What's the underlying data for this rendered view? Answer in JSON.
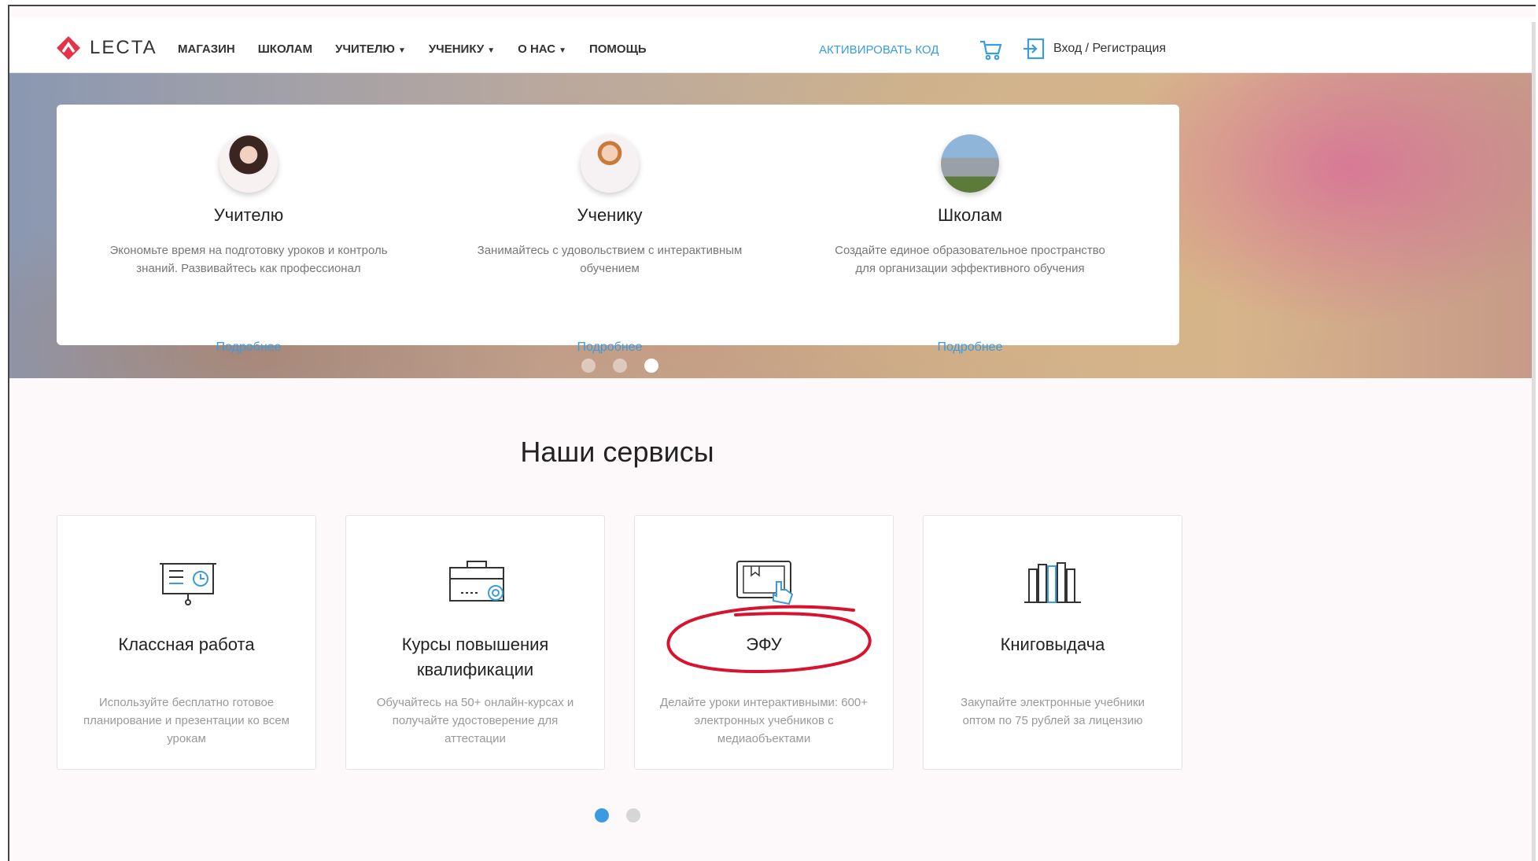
{
  "header": {
    "logo_text": "LECTA",
    "nav": [
      {
        "label": "МАГАЗИН",
        "dropdown": false
      },
      {
        "label": "ШКОЛАМ",
        "dropdown": false
      },
      {
        "label": "УЧИТЕЛЮ",
        "dropdown": true
      },
      {
        "label": "УЧЕНИКУ",
        "dropdown": true
      },
      {
        "label": "О НАС",
        "dropdown": true
      },
      {
        "label": "ПОМОЩЬ",
        "dropdown": false
      }
    ],
    "activate_label": "АКТИВИРОВАТЬ КОД",
    "login_label": "Вход / Регистрация"
  },
  "hero": {
    "audiences": [
      {
        "title": "Учителю",
        "description": "Экономьте время на подготовку уроков и контроль знаний. Развивайтесь как профессионал",
        "link": "Подробнее"
      },
      {
        "title": "Ученику",
        "description": "Занимайтесь с удовольствием с интерактивным обучением",
        "link": "Подробнее"
      },
      {
        "title": "Школам",
        "description": "Создайте единое образовательное пространство для организации эффективного обучения",
        "link": "Подробнее"
      }
    ],
    "carousel_active_index": 2,
    "carousel_count": 3
  },
  "services": {
    "title": "Наши сервисы",
    "items": [
      {
        "title": "Классная работа",
        "description": "Используйте бесплатно готовое планирование и презентации ко всем урокам",
        "icon": "presentation-board-icon"
      },
      {
        "title": "Курсы повышения квалификации",
        "description": "Обучайтесь на 50+ онлайн-курсах и получайте удостоверение для аттестации",
        "icon": "briefcase-certificate-icon"
      },
      {
        "title": "ЭФУ",
        "description": "Делайте уроки интерактивными: 600+ электронных учебников с медиаобъектами",
        "icon": "tablet-touch-icon"
      },
      {
        "title": "Книговыдача",
        "description": "Закупайте электронные учебники оптом по 75 рублей за лицензию",
        "icon": "bookshelf-icon"
      }
    ],
    "carousel_active_index": 0,
    "carousel_count": 2
  },
  "colors": {
    "accent": "#3a9be0",
    "brand_red": "#e53349",
    "annotation_red": "#d8132f"
  }
}
